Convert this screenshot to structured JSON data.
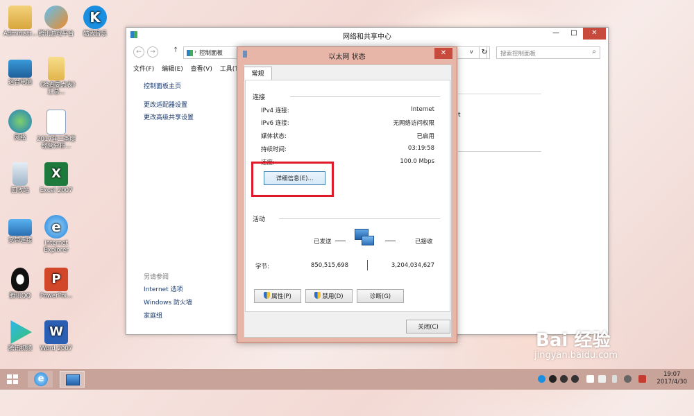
{
  "desktop_icons": [
    {
      "id": "admin",
      "label": "Administr..."
    },
    {
      "id": "tencent-game",
      "label": "腾讯游戏平台"
    },
    {
      "id": "kuwo",
      "label": "酷我音乐"
    },
    {
      "id": "this-pc",
      "label": "这台电脑"
    },
    {
      "id": "folder",
      "label": "《检查要点表》汇总..."
    },
    {
      "id": "network",
      "label": "网络"
    },
    {
      "id": "doc2017",
      "label": "2017年二季度经营分析..."
    },
    {
      "id": "recycle",
      "label": "回收站"
    },
    {
      "id": "excel",
      "label": "Excel 2007"
    },
    {
      "id": "broadband",
      "label": "宽带连接"
    },
    {
      "id": "ie",
      "label": "Internet Explorer"
    },
    {
      "id": "qq",
      "label": "腾讯QQ"
    },
    {
      "id": "ppt",
      "label": "PowerPoi..."
    },
    {
      "id": "tencent-video",
      "label": "腾讯视频"
    },
    {
      "id": "word",
      "label": "Word 2007"
    }
  ],
  "explorer": {
    "title": "网络和共享中心",
    "breadcrumb": "控制面板",
    "search_placeholder": "搜索控制面板",
    "menu": [
      "文件(F)",
      "编辑(E)",
      "查看(V)",
      "工具(T)"
    ],
    "side_links": [
      "控制面板主页",
      "更改适配器设置",
      "更改高级共享设置"
    ],
    "see_also_header": "另请参阅",
    "see_also": [
      "Internet 选项",
      "Windows 防火墙",
      "家庭组"
    ],
    "content_fragment": "t"
  },
  "dialog": {
    "title": "以太网 状态",
    "tab": "常规",
    "connection_header": "连接",
    "rows": [
      {
        "label": "IPv4 连接:",
        "value": "Internet"
      },
      {
        "label": "IPv6 连接:",
        "value": "无网络访问权限"
      },
      {
        "label": "媒体状态:",
        "value": "已启用"
      },
      {
        "label": "持续时间:",
        "value": "03:19:58"
      },
      {
        "label": "速度:",
        "value": "100.0 Mbps"
      }
    ],
    "details_button": "详细信息(E)...",
    "activity_header": "活动",
    "sent_label": "已发送",
    "received_label": "已接收",
    "bytes_label": "字节:",
    "bytes_sent": "850,515,698",
    "bytes_received": "3,204,034,627",
    "properties_button": "属性(P)",
    "disable_button": "禁用(D)",
    "diagnose_button": "诊断(G)",
    "close_button": "关闭(C)"
  },
  "taskbar": {
    "time": "19:07",
    "date": "2017/4/30"
  },
  "watermark": {
    "brand": "Bai  经验",
    "url": "jingyan.baidu.com"
  },
  "colors": {
    "highlight_box": "#e0192a",
    "dialog_frame": "#e7b6a9",
    "taskbar": "#c8a39a"
  }
}
